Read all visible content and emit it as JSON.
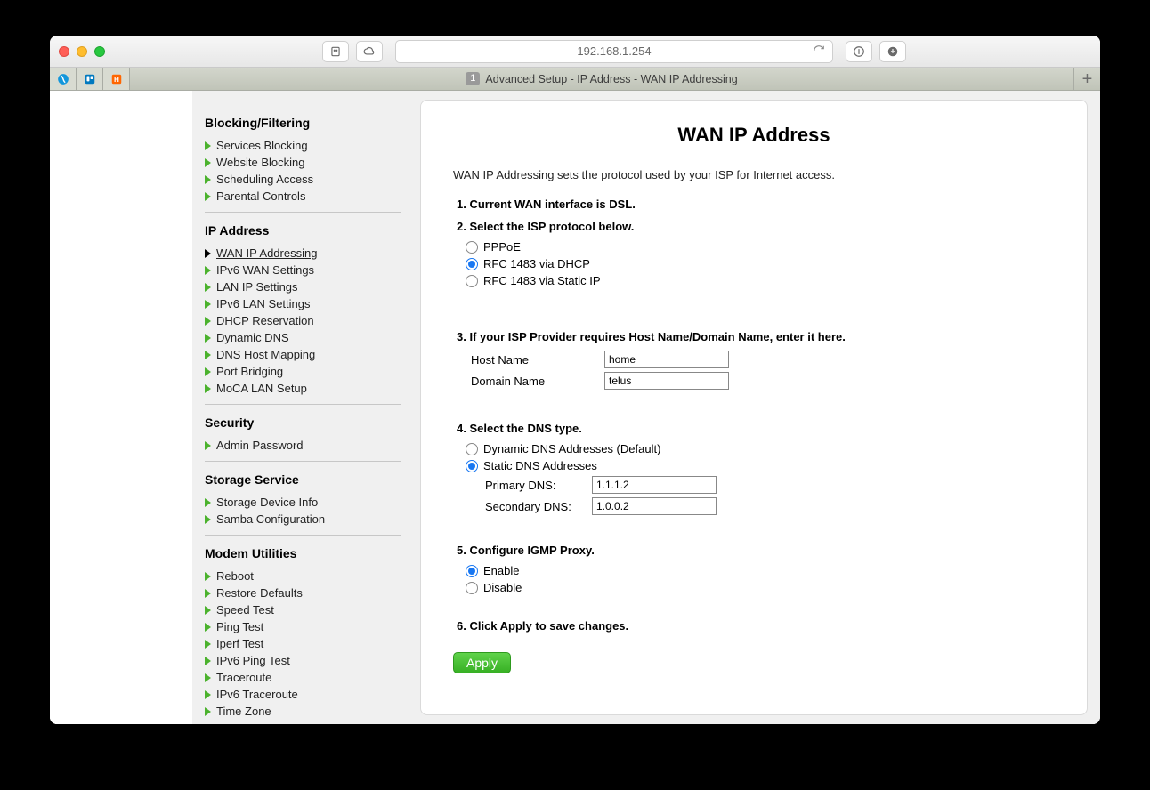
{
  "window": {
    "url": "192.168.1.254",
    "tab_count": "1",
    "tab_title": "Advanced Setup - IP Address - WAN IP Addressing"
  },
  "sidebar": {
    "sections": [
      {
        "title": "Blocking/Filtering",
        "items": [
          {
            "label": "Services Blocking"
          },
          {
            "label": "Website Blocking"
          },
          {
            "label": "Scheduling Access"
          },
          {
            "label": "Parental Controls"
          }
        ]
      },
      {
        "title": "IP Address",
        "items": [
          {
            "label": "WAN IP Addressing",
            "current": true
          },
          {
            "label": "IPv6 WAN Settings"
          },
          {
            "label": "LAN IP Settings"
          },
          {
            "label": "IPv6 LAN Settings"
          },
          {
            "label": "DHCP Reservation"
          },
          {
            "label": "Dynamic DNS"
          },
          {
            "label": "DNS Host Mapping"
          },
          {
            "label": "Port Bridging"
          },
          {
            "label": "MoCA LAN Setup"
          }
        ]
      },
      {
        "title": "Security",
        "items": [
          {
            "label": "Admin Password"
          }
        ]
      },
      {
        "title": "Storage Service",
        "items": [
          {
            "label": "Storage Device Info"
          },
          {
            "label": "Samba Configuration"
          }
        ]
      },
      {
        "title": "Modem Utilities",
        "items": [
          {
            "label": "Reboot"
          },
          {
            "label": "Restore Defaults"
          },
          {
            "label": "Speed Test"
          },
          {
            "label": "Ping Test"
          },
          {
            "label": "Iperf Test"
          },
          {
            "label": "IPv6 Ping Test"
          },
          {
            "label": "Traceroute"
          },
          {
            "label": "IPv6 Traceroute"
          },
          {
            "label": "Time Zone"
          }
        ]
      }
    ]
  },
  "page": {
    "title": "WAN IP Address",
    "intro": "WAN IP Addressing sets the protocol used by your ISP for Internet access.",
    "step1": "1. Current WAN interface is DSL.",
    "step2": "2. Select the ISP protocol below.",
    "protocols": [
      {
        "label": "PPPoE",
        "checked": false
      },
      {
        "label": "RFC 1483 via DHCP",
        "checked": true
      },
      {
        "label": "RFC 1483 via Static IP",
        "checked": false
      }
    ],
    "step3": "3. If your ISP Provider requires Host Name/Domain Name, enter it here.",
    "host_name_label": "Host Name",
    "host_name_value": "home",
    "domain_name_label": "Domain Name",
    "domain_name_value": "telus",
    "step4": "4. Select the DNS type.",
    "dns_types": [
      {
        "label": "Dynamic DNS Addresses (Default)",
        "checked": false
      },
      {
        "label": "Static DNS Addresses",
        "checked": true
      }
    ],
    "primary_dns_label": "Primary DNS:",
    "primary_dns_value": "1.1.1.2",
    "secondary_dns_label": "Secondary DNS:",
    "secondary_dns_value": "1.0.0.2",
    "step5": "5. Configure IGMP Proxy.",
    "igmp": [
      {
        "label": "Enable",
        "checked": true
      },
      {
        "label": "Disable",
        "checked": false
      }
    ],
    "step6": "6. Click Apply to save changes.",
    "apply_label": "Apply"
  }
}
